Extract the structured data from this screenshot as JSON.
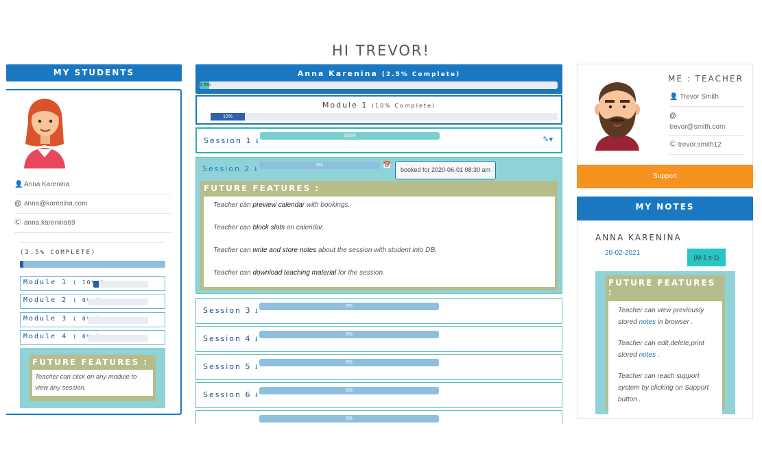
{
  "page_title": "HI TREVOR!",
  "left": {
    "header": "MY STUDENTS",
    "student": {
      "name": "Anna Karenina",
      "email": "anna@karenina.com",
      "skype": "anna.karenina69"
    },
    "overall_label": "(2.5% COMPLETE)",
    "overall_progress": 0.025,
    "modules": [
      {
        "label": "Module 1",
        "pct": "( 10% )",
        "progress": 0.1
      },
      {
        "label": "Module 2",
        "pct": "( 0% )",
        "progress": 0
      },
      {
        "label": "Module 3",
        "pct": "( 0% )",
        "progress": 0
      },
      {
        "label": "Module 4",
        "pct": "( 0% )",
        "progress": 0
      }
    ],
    "future": {
      "title": "FUTURE FEATURES :",
      "text": "Teacher can click on any module to view any session."
    }
  },
  "center": {
    "student_title": "Anna Karenina",
    "student_complete": "(2.5% Complete)",
    "student_bar_label": "2.5%",
    "student_progress": 0.025,
    "module_title": "Module 1",
    "module_complete": "(10% Complete)",
    "module_bar_label": "10%",
    "module_progress": 0.1,
    "sessions": [
      {
        "label": "Session 1",
        "bar": "100%"
      },
      {
        "label": "Session 2",
        "bar": "0%"
      },
      {
        "label": "Session 3",
        "bar": "0%"
      },
      {
        "label": "Session 4",
        "bar": "0%"
      },
      {
        "label": "Session 5",
        "bar": "0%"
      },
      {
        "label": "Session 6",
        "bar": "0%"
      },
      {
        "label": "",
        "bar": "0%"
      }
    ],
    "booked": "booked for 2020-06-01 08:30 am",
    "future": {
      "title": "FUTURE FEATURES :",
      "items": [
        {
          "pre": "Teacher can ",
          "em": "preview calendar",
          "post": " with bookings."
        },
        {
          "pre": "Teacher can ",
          "em": "block slots",
          "post": " on calendar."
        },
        {
          "pre": "Teacher can ",
          "em": "write and store notes",
          "post": " about the session with student into DB."
        },
        {
          "pre": "Teacher can ",
          "em": "download teaching material",
          "post": " for the session."
        }
      ]
    }
  },
  "right": {
    "me_title": "ME : TEACHER",
    "teacher": {
      "name": "Trevor Smith",
      "email_icon": "@",
      "email": "trevor@smith.com",
      "skype": "trevor.smith12"
    },
    "support": "Support",
    "notes_header": "MY NOTES",
    "note_student": "ANNA KARENINA",
    "note_date": "20-02-2021",
    "note_tag": "(M-1 s-1)",
    "future": {
      "title": "FUTURE FEATURES :",
      "p1_pre": "Teacher can view previously stored ",
      "p1_link": "notes",
      "p1_post": " in browser .",
      "p2_pre": "Teacher can edit,delete,print stored ",
      "p2_link": "notes",
      "p2_post": " .",
      "p3": "Teacher can reach support system by clicking on Support button ."
    }
  },
  "colors": {
    "brand_blue": "#1a78c2",
    "teal": "#8fd3d8",
    "olive": "#b6bc8a",
    "orange": "#f6921e"
  },
  "icons": [
    "user-icon",
    "at-icon",
    "skype-icon",
    "download-icon",
    "edit-icon",
    "calendar-icon"
  ]
}
